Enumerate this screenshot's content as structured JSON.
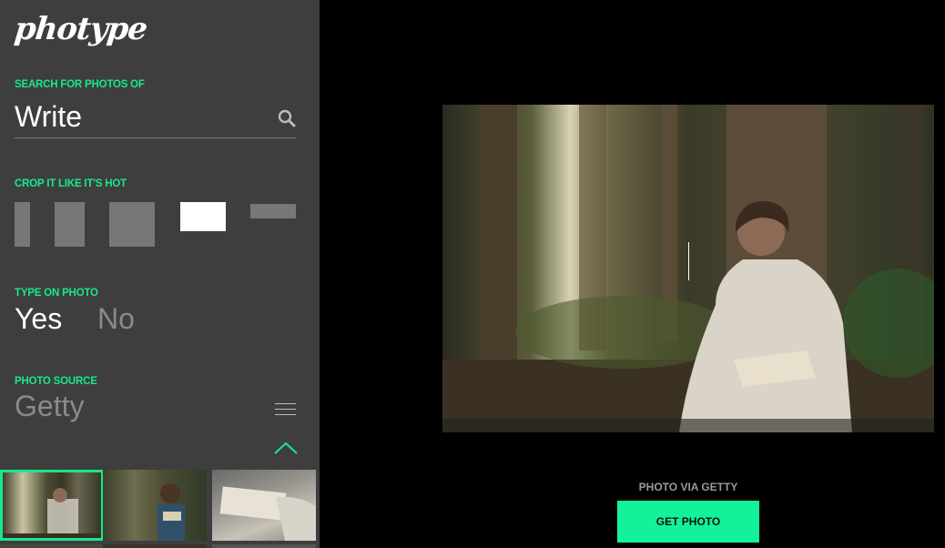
{
  "app": {
    "logo_text": "photype"
  },
  "search": {
    "label": "SEARCH FOR PHOTOS OF",
    "value": "Write"
  },
  "crop": {
    "label": "CROP IT LIKE IT'S HOT",
    "options": [
      "narrow-portrait",
      "portrait",
      "square",
      "landscape",
      "wide-banner"
    ],
    "selected": "landscape"
  },
  "type_on_photo": {
    "label": "TYPE ON PHOTO",
    "yes": "Yes",
    "no": "No",
    "selected": "Yes"
  },
  "photo_source": {
    "label": "PHOTO SOURCE",
    "value": "Getty"
  },
  "main": {
    "credit": "PHOTO VIA GETTY",
    "button": "GET PHOTO"
  },
  "colors": {
    "accent": "#17e88e",
    "button": "#12f29a",
    "sidebar": "#3e3e3e",
    "background": "#000000"
  },
  "icons": [
    "search-icon",
    "menu-icon",
    "chevron-up-icon"
  ]
}
